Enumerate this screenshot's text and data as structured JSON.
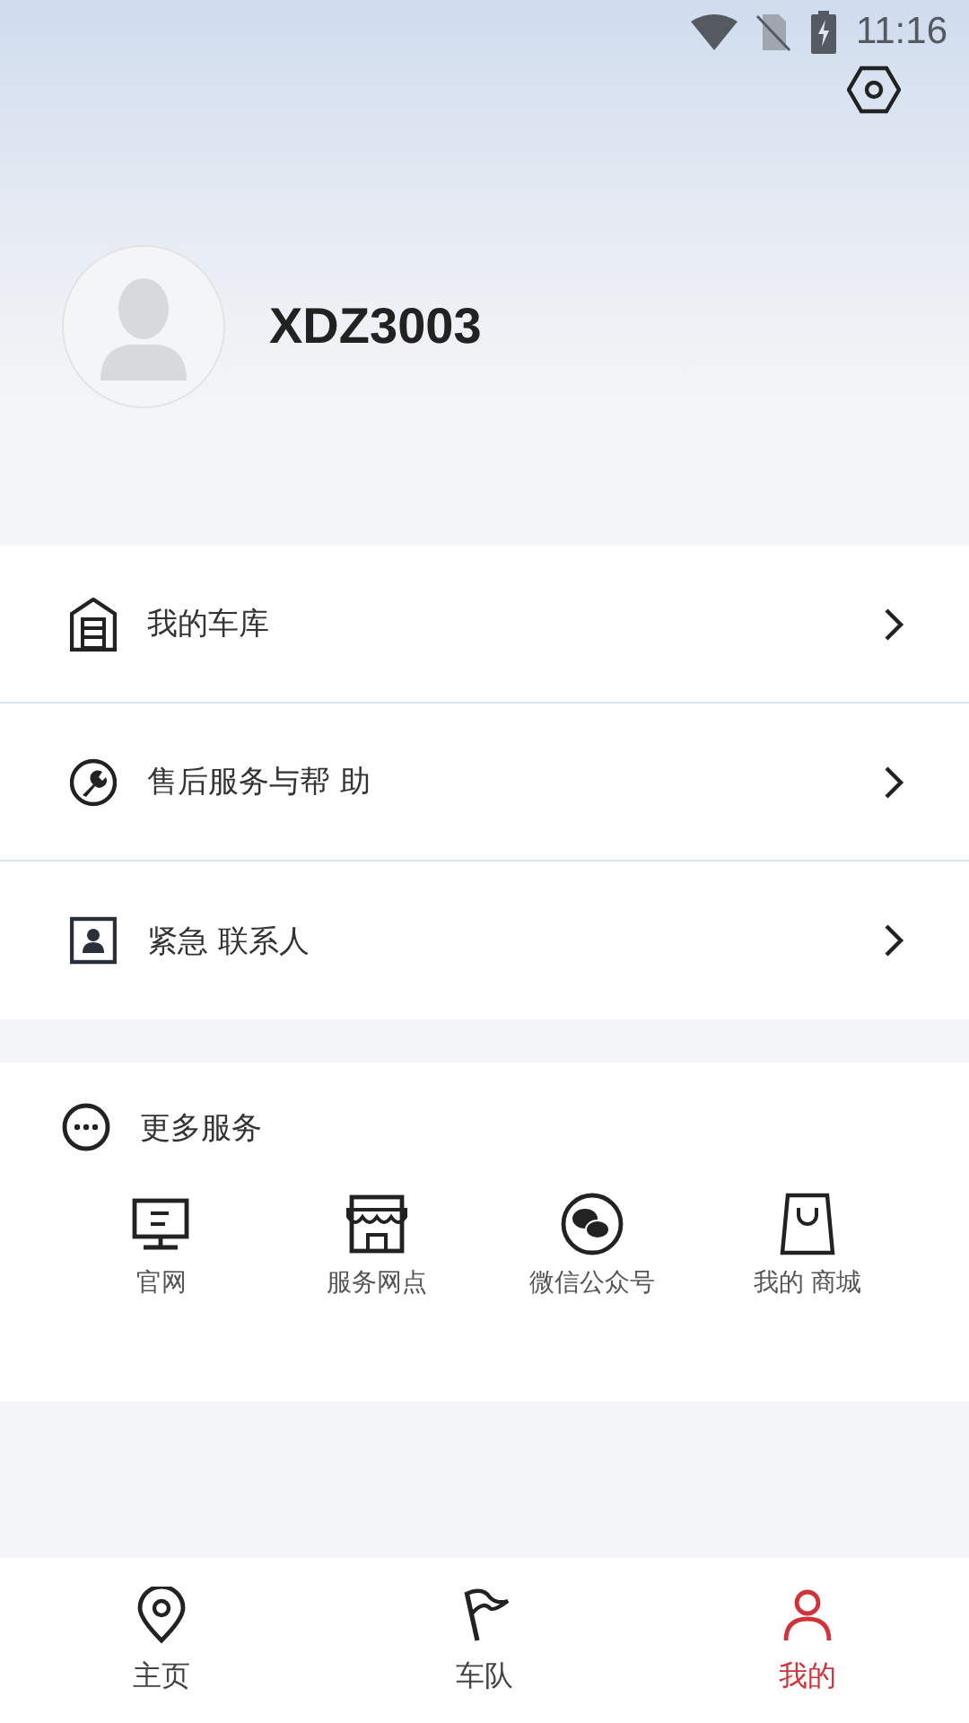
{
  "status_bar": {
    "time": "11:16"
  },
  "profile": {
    "username": "XDZ3003"
  },
  "menu": [
    {
      "kind": "garage",
      "label": "我的车库"
    },
    {
      "kind": "wrench",
      "label": "售后服务与帮 助"
    },
    {
      "kind": "contact",
      "label": "紧急 联系人"
    }
  ],
  "more_services": {
    "title": "更多服务",
    "items": [
      {
        "kind": "monitor",
        "label": "官网"
      },
      {
        "kind": "store",
        "label": "服务网点"
      },
      {
        "kind": "wechat",
        "label": "微信公众号"
      },
      {
        "kind": "bag",
        "label": "我的 商城"
      }
    ]
  },
  "bottom_nav": [
    {
      "kind": "pin",
      "label": "主页",
      "selected": false
    },
    {
      "kind": "flag",
      "label": "车队",
      "selected": false
    },
    {
      "kind": "person",
      "label": "我的",
      "selected": true
    }
  ]
}
